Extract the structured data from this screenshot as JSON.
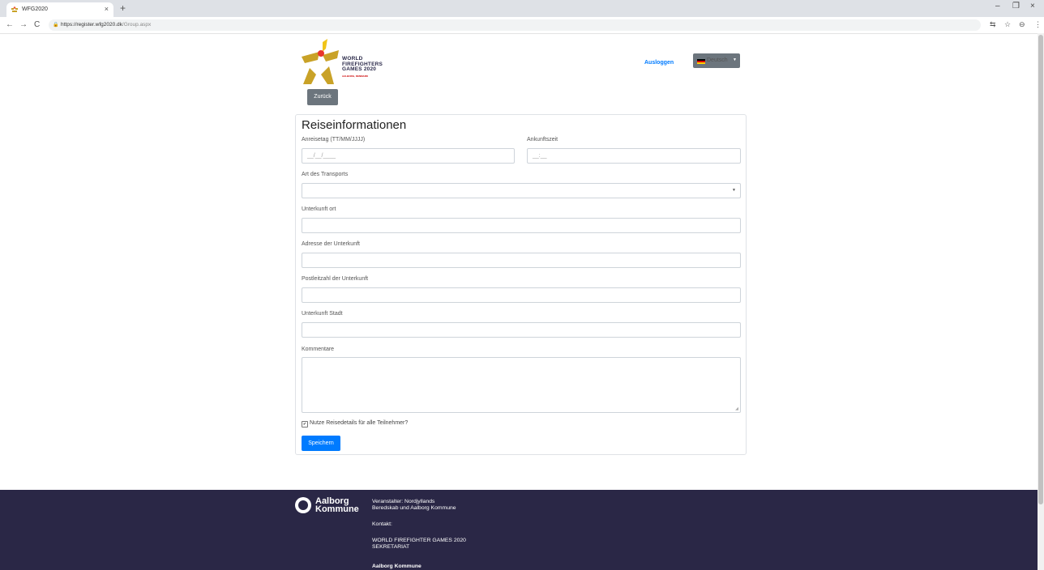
{
  "browser": {
    "tab_title": "WFG2020",
    "tab_close": "×",
    "new_tab": "+",
    "url_host": "https://register.wfg2020.dk",
    "url_path": "/Group.aspx",
    "nav_back": "←",
    "nav_forward": "→",
    "nav_reload": "C",
    "win_min": "–",
    "win_max": "❐",
    "win_close": "×",
    "icon_translate": "⇆",
    "icon_star": "☆",
    "icon_profile": "⊖",
    "icon_menu": "⋮"
  },
  "header": {
    "logo_line1": "WORLD",
    "logo_line2": "FIREFIGHTERS",
    "logo_line3": "GAMES 2020",
    "logo_sub": "AALBORG, DENMARK",
    "logout_label": "Ausloggen",
    "language_label": "Deutsch",
    "back_label": "Zurück"
  },
  "form": {
    "title": "Reiseinformationen",
    "arrival_date_label": "Anreisetag (TT/MM/JJJJ)",
    "arrival_date_placeholder": "__/__/____",
    "arrival_time_label": "Ankunftszeit",
    "arrival_time_placeholder": "__:__",
    "transport_label": "Art des Transports",
    "transport_value": "",
    "accommodation_place_label": "Unterkunft ort",
    "accommodation_address_label": "Adresse der Unterkunft",
    "accommodation_zip_label": "Postleitzahl der Unterkunft",
    "accommodation_city_label": "Unterkunft Stadt",
    "comments_label": "Kommentare",
    "use_for_all_label": "Nutze Reisedetails für alle Teilnehmer?",
    "use_for_all_checked": true,
    "save_label": "Speichern"
  },
  "footer": {
    "brand_line1": "Aalborg",
    "brand_line2": "Kommune",
    "organizer_line1": "Veranstalter: Nordjyllands",
    "organizer_line2": "Beredskab und Aalborg Kommune",
    "contact_label": "Kontakt:",
    "contact_line1": "WORLD FIREFIGHTER GAMES 2020",
    "contact_line2": "SEKRETARIAT",
    "contact_line3": "Aalborg Kommune"
  },
  "colors": {
    "primary": "#007bff",
    "secondary": "#6c757d",
    "footer_bg": "#2a2746"
  }
}
